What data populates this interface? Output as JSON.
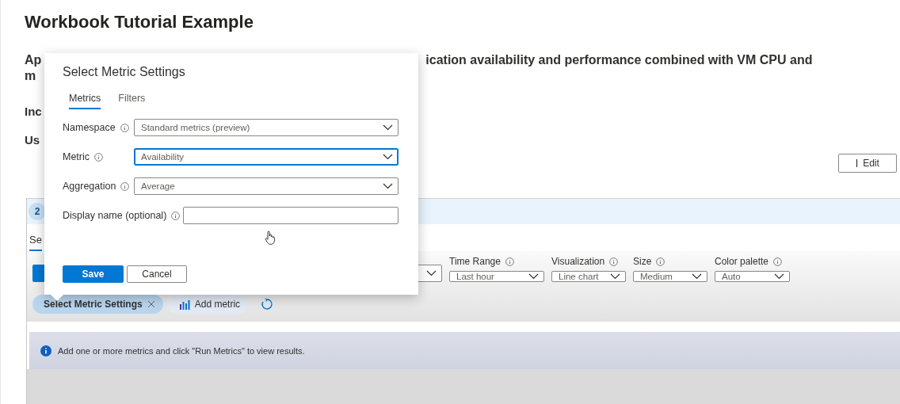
{
  "page": {
    "title": "Workbook Tutorial Example"
  },
  "description": {
    "line_1_start": "Ap",
    "line_1_end": "ication availability and performance combined with VM CPU and",
    "line_2_start": "m"
  },
  "section_headings": [
    "Inc",
    "Us"
  ],
  "edit_button": {
    "label": "Edit"
  },
  "step": {
    "number": "2",
    "tab": {
      "label": "Se",
      "selected": true
    }
  },
  "query_controls": [
    {
      "label": "Time Range",
      "value": "Last hour"
    },
    {
      "label": "Visualization",
      "value": "Line chart"
    },
    {
      "label": "Size",
      "value": "Medium"
    },
    {
      "label": "Color palette",
      "value": "Auto"
    }
  ],
  "metric_chips": [
    {
      "label": "Select Metric Settings",
      "kind": "selected"
    },
    {
      "label": "Add metric",
      "kind": "add"
    }
  ],
  "info_message": "Add one or more metrics and click \"Run Metrics\" to view results.",
  "dialog": {
    "title": "Select Metric Settings",
    "tabs": [
      {
        "label": "Metrics",
        "selected": true
      },
      {
        "label": "Filters",
        "selected": false
      }
    ],
    "fields": [
      {
        "label": "Namespace",
        "kind": "dropdown",
        "value": "Standard metrics (preview)",
        "focused": false
      },
      {
        "label": "Metric",
        "kind": "dropdown",
        "value": "Availability",
        "focused": true
      },
      {
        "label": "Aggregation",
        "kind": "dropdown",
        "value": "Average",
        "focused": false
      },
      {
        "label": "Display name (optional)",
        "kind": "text",
        "focused": false
      }
    ],
    "buttons": [
      {
        "label": "Save",
        "kind": "primary"
      },
      {
        "label": "Cancel",
        "kind": "secondary"
      }
    ]
  }
}
